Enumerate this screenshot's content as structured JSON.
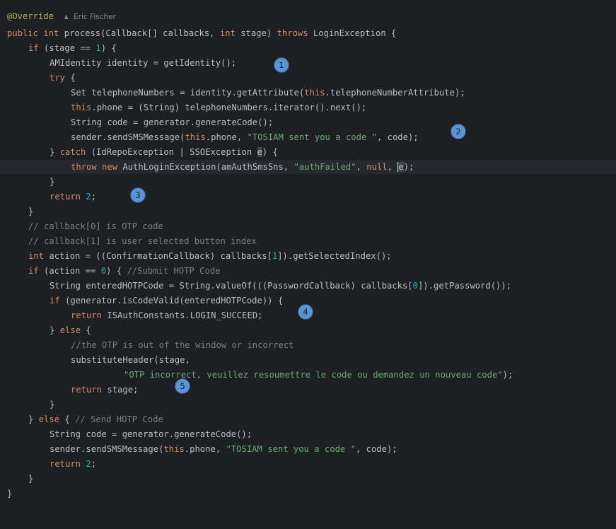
{
  "author": {
    "name": "Eric Fischer",
    "icon": "person-icon"
  },
  "code": {
    "annotation": "@Override",
    "signature": [
      "public",
      "int",
      "process(Callback[] callbacks, ",
      "int",
      " stage) ",
      "throws",
      " LoginException {"
    ],
    "if_stage": [
      "if",
      " (stage == ",
      "1",
      ") {"
    ],
    "get_identity": "AMIdentity identity = getIdentity();",
    "try": [
      "try",
      " {"
    ],
    "set_phones": [
      "Set telephoneNumbers = identity.getAttribute(",
      "this",
      ".telephoneNumberAttribute);"
    ],
    "phone_assign": [
      "this",
      ".phone = (String) telephoneNumbers.iterator().next();"
    ],
    "code_gen": "String code = generator.generateCode();",
    "send_sms": [
      "sender.sendSMSMessage(",
      "this",
      ".phone, ",
      "\"TOSIAM sent you a code \"",
      ", code);"
    ],
    "catch": [
      "} ",
      "catch",
      " (IdRepoException | SSOException ",
      "e",
      ") {"
    ],
    "throw": [
      "throw",
      " ",
      "new",
      " AuthLoginException(amAuthSmsSns, ",
      "\"authFailed\"",
      ", ",
      "null",
      ", ",
      "e",
      ");"
    ],
    "close_brace": "}",
    "return_2": [
      "return",
      " ",
      "2",
      ";"
    ],
    "comment1": "// callback[0] is OTP code",
    "comment2": "// callback[1] is user selected button index",
    "action": [
      "int",
      " action = ((ConfirmationCallback) callbacks[",
      "1",
      "]).getSelectedIndex();"
    ],
    "if_action": [
      "if",
      " (action == ",
      "0",
      ") { ",
      "//Submit HOTP Code"
    ],
    "entered_code": [
      "String enteredHOTPCode = String.valueOf(((PasswordCallback) callbacks[",
      "0",
      "]).getPassword());"
    ],
    "if_valid": [
      "if",
      " (generator.isCodeValid(enteredHOTPCode)) {"
    ],
    "return_succeed": [
      "return",
      " ISAuthConstants.LOGIN_SUCCEED;"
    ],
    "else": [
      "} ",
      "else",
      " {"
    ],
    "otp_comment": "//the OTP is out of the window or incorrect",
    "subst_header": "substituteHeader(stage,",
    "otp_message": [
      "\"OTP incorrect, veuillez resoumettre le code ou demandez un nouveau code\"",
      ");"
    ],
    "return_stage": [
      "return",
      " stage;"
    ],
    "else_send": [
      "} ",
      "else",
      " { ",
      "// Send HOTP Code"
    ]
  },
  "markers": [
    "1",
    "2",
    "3",
    "4",
    "5"
  ]
}
